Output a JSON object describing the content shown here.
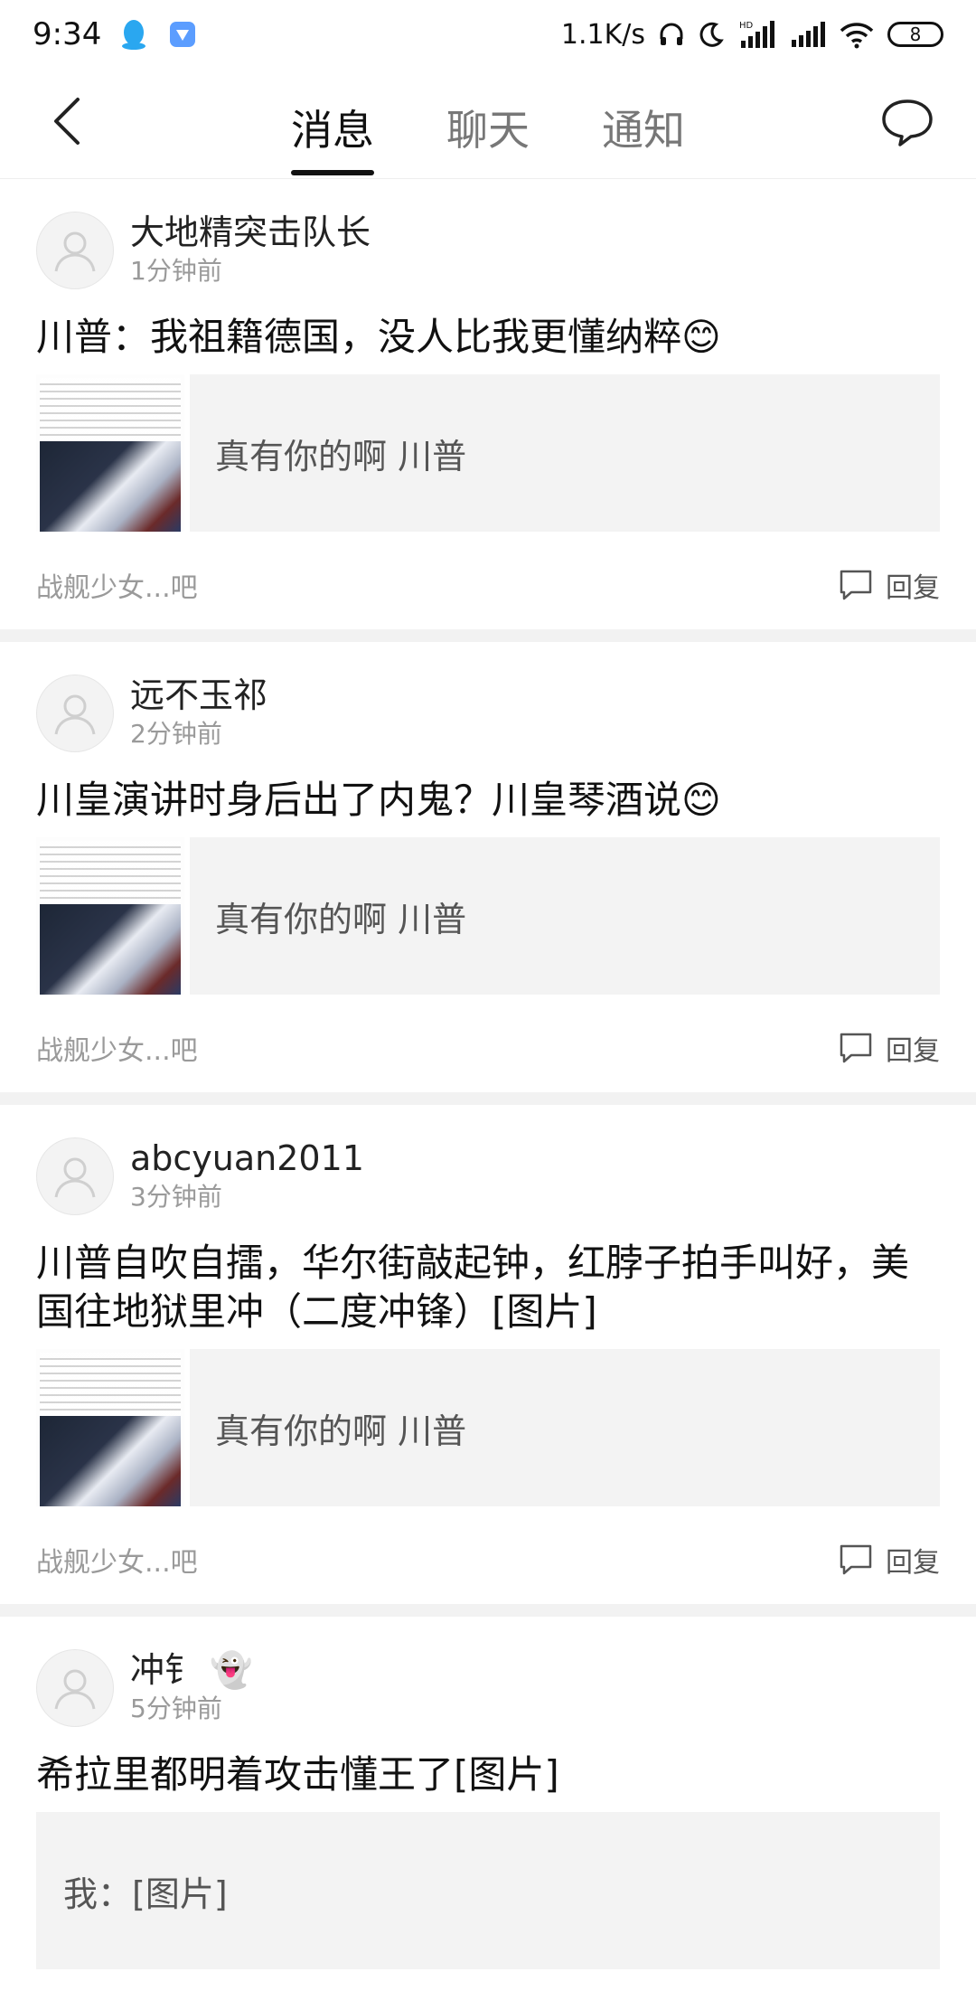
{
  "status_bar": {
    "time": "9:34",
    "net_speed": "1.1K/s",
    "signal_hd": "HD",
    "battery": "8"
  },
  "nav": {
    "tabs": [
      "消息",
      "聊天",
      "通知"
    ],
    "active_tab": 0
  },
  "posts": [
    {
      "user": "大地精突击队长",
      "time": "1分钟前",
      "title": "川普：我祖籍德国，没人比我更懂纳粹",
      "title_emoji": "😊",
      "quote": "真有你的啊  川普",
      "has_thumb": true,
      "forum": "战舰少女...吧",
      "reply_label": "回复"
    },
    {
      "user": "远不玉祁",
      "time": "2分钟前",
      "title": "川皇演讲时身后出了内鬼？川皇琴酒说",
      "title_emoji": "😊",
      "quote": "真有你的啊  川普",
      "has_thumb": true,
      "forum": "战舰少女...吧",
      "reply_label": "回复"
    },
    {
      "user": "abcyuan2011",
      "time": "3分钟前",
      "title": "川普自吹自擂，华尔街敲起钟，红脖子拍手叫好，美国往地狱里冲（二度冲锋）[图片]",
      "title_emoji": "",
      "quote": "真有你的啊  川普",
      "has_thumb": true,
      "forum": "战舰少女...吧",
      "reply_label": "回复"
    },
    {
      "user": "冲钅",
      "user_emoji": "👻",
      "time": "5分钟前",
      "title": "希拉里都明着攻击懂王了[图片]",
      "title_emoji": "",
      "quote": "我：[图片]",
      "has_thumb": false,
      "forum": "",
      "reply_label": ""
    }
  ],
  "icons": {
    "back": "back-arrow-icon",
    "chat": "chat-bubble-icon",
    "reply": "comment-icon",
    "avatar": "default-avatar-icon"
  },
  "colors": {
    "active_tab": "#111111",
    "inactive_tab": "#777777",
    "quote_bg": "#f3f3f3",
    "separator": "#f2f2f2"
  }
}
